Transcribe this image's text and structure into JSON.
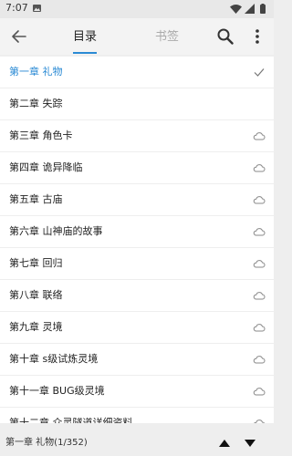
{
  "status_bar": {
    "time": "7:07",
    "icons": [
      "image-notification-icon",
      "wifi-icon",
      "cellular-signal-icon",
      "battery-icon"
    ]
  },
  "app_bar": {
    "icons": {
      "back": "arrow-left-icon",
      "search": "search-icon",
      "more": "more-vertical-icon"
    },
    "tabs": [
      {
        "label": "目录",
        "selected": true
      },
      {
        "label": "书签",
        "selected": false
      }
    ]
  },
  "chapters": [
    {
      "title": "第一章 礼物",
      "status": "current"
    },
    {
      "title": "第二章 失踪",
      "status": "none"
    },
    {
      "title": "第三章 角色卡",
      "status": "cloud"
    },
    {
      "title": "第四章 诡异降临",
      "status": "cloud"
    },
    {
      "title": "第五章 古庙",
      "status": "cloud"
    },
    {
      "title": "第六章 山神庙的故事",
      "status": "cloud"
    },
    {
      "title": "第七章 回归",
      "status": "cloud"
    },
    {
      "title": "第八章 联络",
      "status": "cloud"
    },
    {
      "title": "第九章 灵境",
      "status": "cloud"
    },
    {
      "title": "第十章 s级试炼灵境",
      "status": "cloud"
    },
    {
      "title": "第十一章 BUG级灵境",
      "status": "cloud"
    },
    {
      "title": "第十二章 众灵隧道详细资料",
      "status": "cloud"
    }
  ],
  "footer": {
    "current_chapter": "第一章 礼物(1/352)",
    "icons": {
      "prev": "triangle-up-icon",
      "next": "triangle-down-icon"
    }
  },
  "colors": {
    "accent": "#2a8ad4",
    "background": "#eeeeee",
    "list_background": "#ffffff",
    "secondary_text": "#aaaaaa"
  }
}
